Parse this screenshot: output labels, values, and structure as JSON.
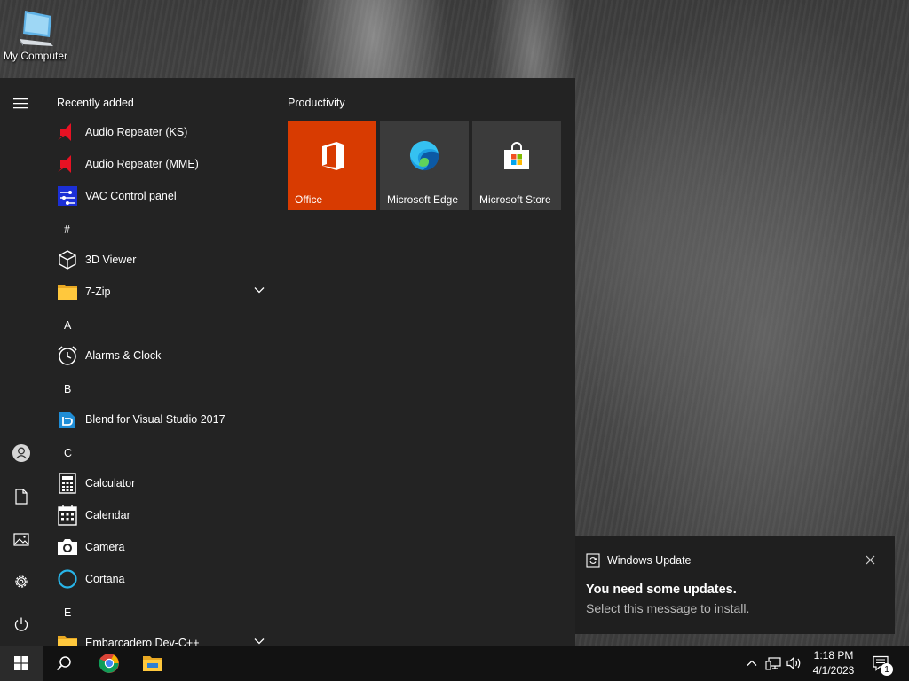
{
  "desktop": {
    "icons": [
      {
        "label": "My Computer",
        "icon": "computer-icon"
      }
    ]
  },
  "start_menu": {
    "rail": [
      {
        "icon": "hamburger-menu-icon"
      },
      {
        "icon": "user-icon"
      },
      {
        "icon": "documents-icon"
      },
      {
        "icon": "pictures-icon"
      },
      {
        "icon": "settings-gear-icon"
      },
      {
        "icon": "power-icon"
      }
    ],
    "recently_added_header": "Recently added",
    "recent": [
      {
        "label": "Audio Repeater (KS)",
        "icon": "audio-repeater-icon"
      },
      {
        "label": "Audio Repeater (MME)",
        "icon": "audio-repeater-icon"
      },
      {
        "label": "VAC Control panel",
        "icon": "vac-control-icon"
      }
    ],
    "letters": {
      "hash": "#",
      "a": "A",
      "b": "B",
      "c": "C",
      "e": "E"
    },
    "apps": [
      {
        "label": "3D Viewer",
        "icon": "cube-icon"
      },
      {
        "label": "7-Zip",
        "icon": "folder-icon",
        "expandable": true
      },
      {
        "label": "Alarms & Clock",
        "icon": "alarm-clock-icon"
      },
      {
        "label": "Blend for Visual Studio 2017",
        "icon": "blend-icon"
      },
      {
        "label": "Calculator",
        "icon": "calculator-icon"
      },
      {
        "label": "Calendar",
        "icon": "calendar-icon"
      },
      {
        "label": "Camera",
        "icon": "camera-icon"
      },
      {
        "label": "Cortana",
        "icon": "cortana-ring-icon"
      },
      {
        "label": "Embarcadero Dev-C++",
        "icon": "folder-icon",
        "expandable": true
      }
    ],
    "tiles_group": "Productivity",
    "tiles": [
      {
        "label": "Office",
        "icon": "office-icon",
        "bg": "#d83b01"
      },
      {
        "label": "Microsoft Edge",
        "icon": "edge-icon",
        "bg": "#3b3b3b"
      },
      {
        "label": "Microsoft Store",
        "icon": "store-bag-icon",
        "bg": "#3b3b3b"
      }
    ]
  },
  "notification": {
    "app": "Windows Update",
    "title": "You need some updates.",
    "message": "Select this message to install."
  },
  "taskbar": {
    "time": "1:18 PM",
    "date": "4/1/2023",
    "notification_count": "1",
    "pinned": [
      "search-icon",
      "chrome-icon",
      "file-explorer-icon"
    ],
    "tray": [
      "chevron-up-icon",
      "network-icon",
      "volume-icon",
      "action-center-icon"
    ]
  },
  "colors": {
    "office_tile": "#d83b01",
    "tile_bg": "#3b3b3b",
    "menu_bg": "#232323",
    "taskbar_bg": "#121212"
  }
}
